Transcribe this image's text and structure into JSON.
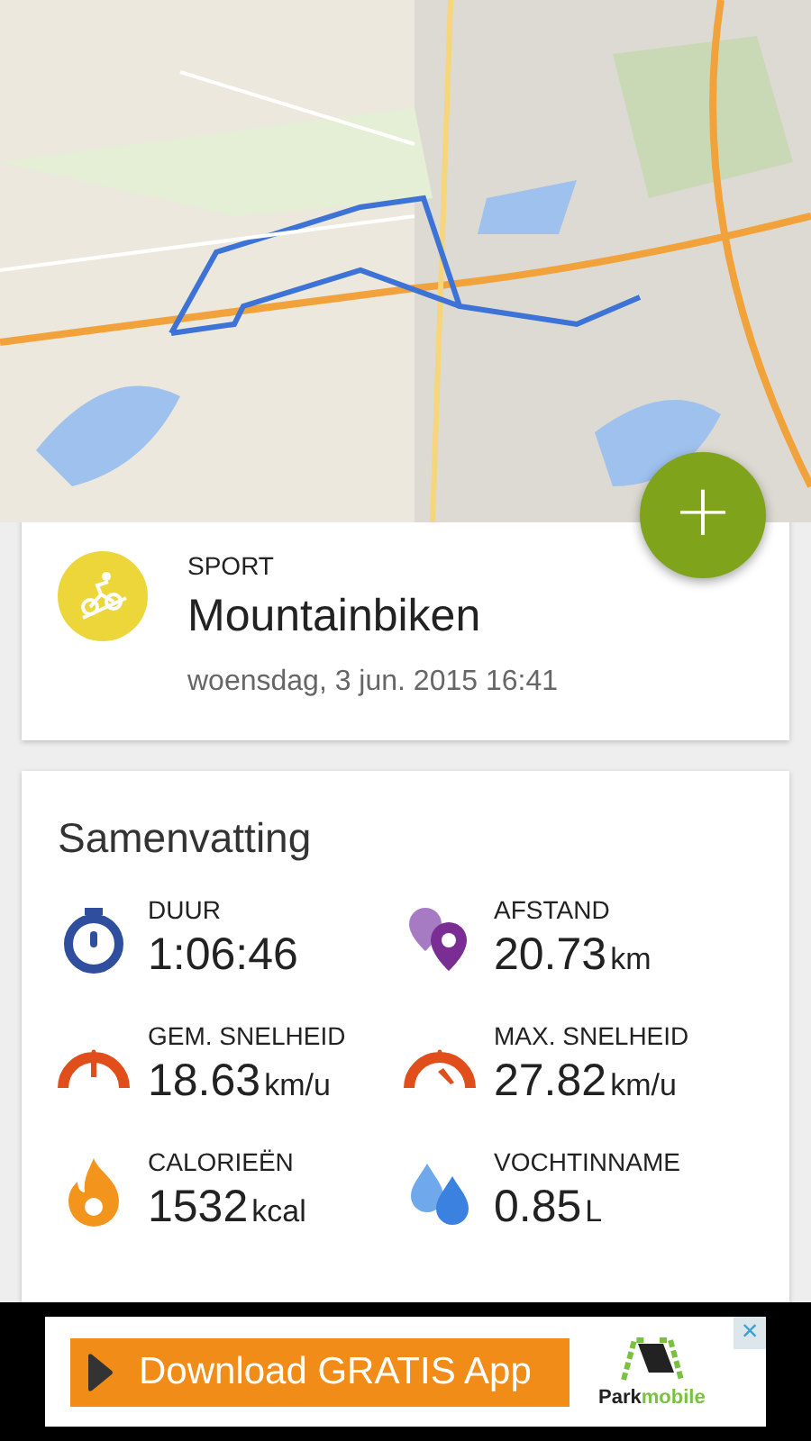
{
  "add_button": {
    "label": "+"
  },
  "activity": {
    "category": "SPORT",
    "name": "Mountainbiken",
    "date": "woensdag, 3 jun. 2015 16:41"
  },
  "summary": {
    "title": "Samenvatting",
    "stats": [
      {
        "kind": "duration",
        "label": "DUUR",
        "value": "1:06:46"
      },
      {
        "kind": "distance",
        "label": "AFSTAND",
        "value": "20.73",
        "unit": "km"
      },
      {
        "kind": "avg_speed",
        "label": "GEM. SNELHEID",
        "value": "18.63",
        "unit": "km/u"
      },
      {
        "kind": "max_speed",
        "label": "MAX. SNELHEID",
        "value": "27.82",
        "unit": "km/u"
      },
      {
        "kind": "calories",
        "label": "CALORIEËN",
        "value": "1532",
        "unit": "kcal"
      },
      {
        "kind": "hydration",
        "label": "VOCHTINNAME",
        "value": "0.85",
        "unit": "L"
      }
    ]
  },
  "ad": {
    "button": "Download GRATIS App",
    "brand": "**Park**mobile",
    "close": "×"
  }
}
